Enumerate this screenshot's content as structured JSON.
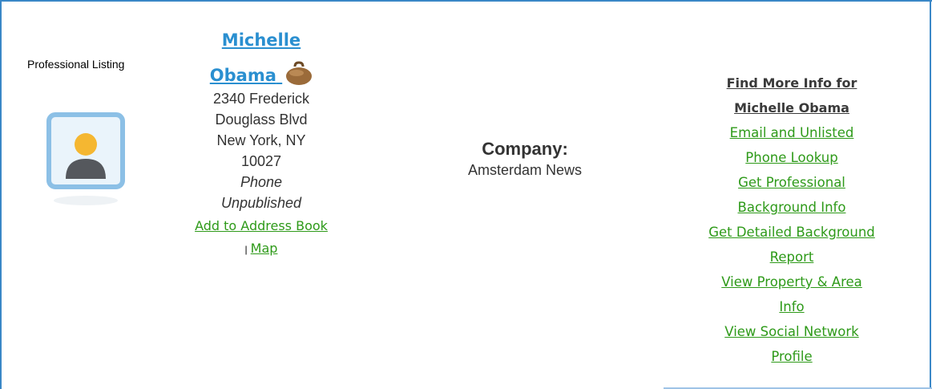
{
  "listing_type": "Professional Listing",
  "person": {
    "first_name": "Michelle",
    "last_name": "Obama",
    "address": [
      "2340 Frederick",
      "Douglass Blvd",
      "New York, NY",
      "10027"
    ],
    "phone": [
      "Phone",
      "Unpublished"
    ],
    "add_to_address_book": "Add to Address Book",
    "separator": "|",
    "map": "Map"
  },
  "company": {
    "label": "Company:",
    "name": "Amsterdam News"
  },
  "more_info": {
    "heading": [
      "Find More Info for",
      "Michelle Obama"
    ],
    "links": [
      [
        "Email and Unlisted",
        "Phone Lookup"
      ],
      [
        "Get Professional",
        "Background Info"
      ],
      [
        "Get Detailed Background",
        "Report"
      ],
      [
        "View Property & Area",
        "Info"
      ],
      [
        "View Social Network",
        "Profile"
      ]
    ]
  },
  "colors": {
    "frame": "#3a87c7",
    "name_link": "#2a8fd0",
    "green_link": "#2e9a19",
    "text": "#333333"
  },
  "icons": {
    "avatar": "default-user-avatar-icon",
    "briefcase": "briefcase-icon"
  }
}
